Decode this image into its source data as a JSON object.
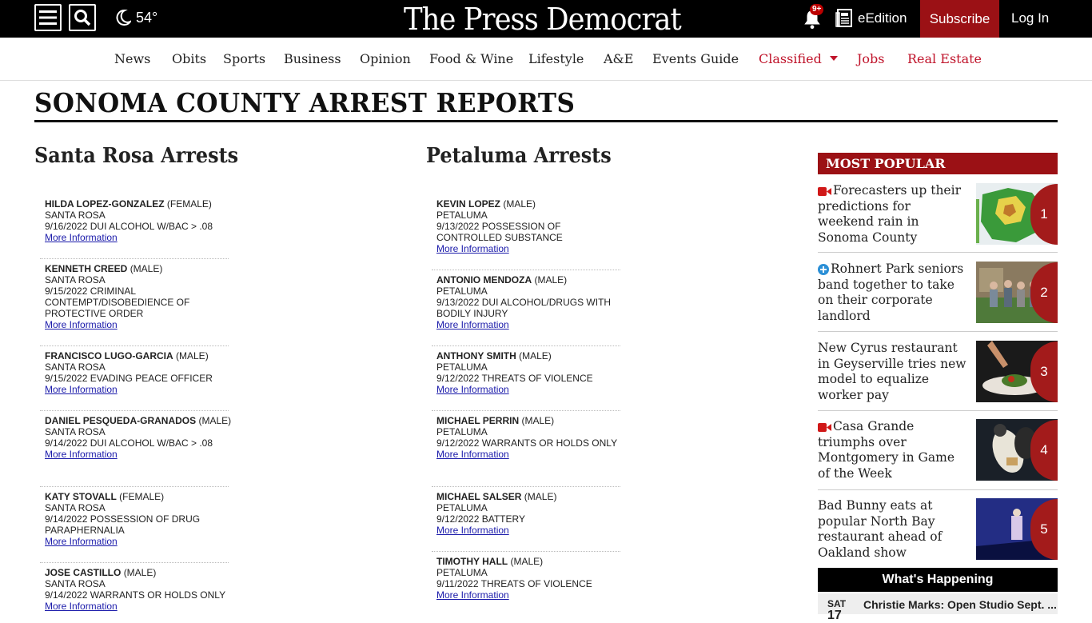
{
  "header": {
    "temperature": "54°",
    "logo": "The Press Democrat",
    "notification_badge": "9+",
    "eedition_label": "eEdition",
    "subscribe_label": "Subscribe",
    "login_label": "Log In"
  },
  "nav": {
    "items": [
      "News",
      "Obits",
      "Sports",
      "Business",
      "Opinion",
      "Food & Wine",
      "Lifestyle",
      "A&E",
      "Events Guide",
      "Classified",
      "Jobs",
      "Real Estate"
    ]
  },
  "page_title": "SONOMA COUNTY ARREST REPORTS",
  "santa_rosa": {
    "heading": "Santa Rosa Arrests",
    "entries": [
      {
        "name": "HILDA LOPEZ-GONZALEZ",
        "sex": "(FEMALE)",
        "city": "SANTA ROSA",
        "date": "9/16/2022",
        "charge": "DUI ALCOHOL W/BAC > .08",
        "link": "More Information"
      },
      {
        "name": "KENNETH CREED",
        "sex": "(MALE)",
        "city": "SANTA ROSA",
        "date": "9/15/2022",
        "charge": "CRIMINAL CONTEMPT/DISOBEDIENCE OF PROTECTIVE ORDER",
        "link": "More Information"
      },
      {
        "name": "FRANCISCO LUGO-GARCIA",
        "sex": "(MALE)",
        "city": "SANTA ROSA",
        "date": "9/15/2022",
        "charge": "EVADING PEACE OFFICER",
        "link": "More Information"
      },
      {
        "name": "DANIEL PESQUEDA-GRANADOS",
        "sex": "(MALE)",
        "city": "SANTA ROSA",
        "date": "9/14/2022",
        "charge": "DUI ALCOHOL W/BAC > .08",
        "link": "More Information"
      },
      {
        "name": "KATY STOVALL",
        "sex": "(FEMALE)",
        "city": "SANTA ROSA",
        "date": "9/14/2022",
        "charge": "POSSESSION OF DRUG PARAPHERNALIA",
        "link": "More Information"
      },
      {
        "name": "JOSE CASTILLO",
        "sex": "(MALE)",
        "city": "SANTA ROSA",
        "date": "9/14/2022",
        "charge": "WARRANTS OR HOLDS ONLY",
        "link": "More Information"
      }
    ]
  },
  "petaluma": {
    "heading": "Petaluma Arrests",
    "entries": [
      {
        "name": "KEVIN LOPEZ",
        "sex": "(MALE)",
        "city": "PETALUMA",
        "date": "9/13/2022",
        "charge": "POSSESSION OF CONTROLLED SUBSTANCE",
        "link": "More Information"
      },
      {
        "name": "ANTONIO MENDOZA",
        "sex": "(MALE)",
        "city": "PETALUMA",
        "date": "9/13/2022",
        "charge": "DUI ALCOHOL/DRUGS WITH BODILY INJURY",
        "link": "More Information"
      },
      {
        "name": "ANTHONY SMITH",
        "sex": "(MALE)",
        "city": "PETALUMA",
        "date": "9/12/2022",
        "charge": "THREATS OF VIOLENCE",
        "link": "More Information"
      },
      {
        "name": "MICHAEL PERRIN",
        "sex": "(MALE)",
        "city": "PETALUMA",
        "date": "9/12/2022",
        "charge": "WARRANTS OR HOLDS ONLY",
        "link": "More Information"
      },
      {
        "name": "MICHAEL SALSER",
        "sex": "(MALE)",
        "city": "PETALUMA",
        "date": "9/12/2022",
        "charge": "BATTERY",
        "link": "More Information"
      },
      {
        "name": "TIMOTHY HALL",
        "sex": "(MALE)",
        "city": "PETALUMA",
        "date": "9/11/2022",
        "charge": "THREATS OF VIOLENCE",
        "link": "More Information"
      }
    ]
  },
  "most_popular": {
    "heading": "MOST POPULAR",
    "items": [
      {
        "rank": "1",
        "title": "Forecasters up their predictions for weekend rain in Sonoma County",
        "icon": "video-icon"
      },
      {
        "rank": "2",
        "title": "Rohnert Park seniors band together to take on their corporate landlord",
        "icon": "plus-circle-icon"
      },
      {
        "rank": "3",
        "title": "New Cyrus restaurant in Geyserville tries new model to equalize worker pay",
        "icon": ""
      },
      {
        "rank": "4",
        "title": "Casa Grande triumphs over Montgomery in Game of the Week",
        "icon": "video-icon"
      },
      {
        "rank": "5",
        "title": "Bad Bunny eats at popular North Bay restaurant ahead of Oakland show",
        "icon": ""
      }
    ]
  },
  "whats_happening": {
    "heading": "What's Happening",
    "event": {
      "day": "SAT",
      "date": "17",
      "title": "Christie Marks: Open Studio Sept. ..."
    }
  },
  "colors": {
    "brand_red": "#9b1115",
    "nav_red": "#c0142b",
    "link_blue": "#1a1aaa"
  }
}
